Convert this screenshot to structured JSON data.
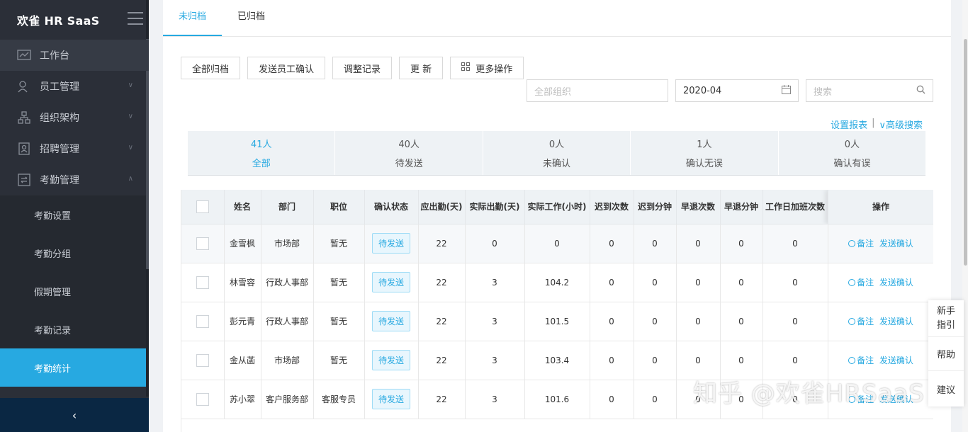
{
  "sidebar": {
    "logo": "欢雀 HR SaaS",
    "menu": [
      {
        "label": "工作台"
      },
      {
        "label": "员工管理"
      },
      {
        "label": "组织架构"
      },
      {
        "label": "招聘管理"
      },
      {
        "label": "考勤管理"
      }
    ],
    "submenu": [
      {
        "label": "考勤设置"
      },
      {
        "label": "考勤分组"
      },
      {
        "label": "假期管理"
      },
      {
        "label": "考勤记录"
      },
      {
        "label": "考勤统计"
      }
    ],
    "collapse_icon": "‹"
  },
  "tabs": [
    {
      "label": "未归档"
    },
    {
      "label": "已归档"
    }
  ],
  "toolbar": {
    "archive_all": "全部归档",
    "send_confirm": "发送员工确认",
    "adjust_log": "调整记录",
    "refresh": "更 新",
    "more": "更多操作"
  },
  "filters": {
    "org_placeholder": "全部组织",
    "month": "2020-04",
    "search_placeholder": "搜索"
  },
  "links": {
    "report_settings": "设置报表",
    "advanced_search": "∨高级搜索"
  },
  "summary": [
    {
      "count": "41人",
      "label": "全部"
    },
    {
      "count": "40人",
      "label": "待发送"
    },
    {
      "count": "0人",
      "label": "未确认"
    },
    {
      "count": "1人",
      "label": "确认无误"
    },
    {
      "count": "0人",
      "label": "确认有误"
    }
  ],
  "table": {
    "headers": [
      "姓名",
      "部门",
      "职位",
      "确认状态",
      "应出勤(天)",
      "实际出勤(天)",
      "实际工作(小时)",
      "迟到次数",
      "迟到分钟",
      "早退次数",
      "早退分钟",
      "工作日加班次数",
      "操作"
    ],
    "rows": [
      {
        "name": "金雪枫",
        "dept": "市场部",
        "pos": "暂无",
        "status": "待发送",
        "due": "22",
        "actual": "0",
        "hours": "0",
        "late": "0",
        "late_min": "0",
        "early": "0",
        "early_min": "0",
        "ot": "0"
      },
      {
        "name": "林雪容",
        "dept": "行政人事部",
        "pos": "暂无",
        "status": "待发送",
        "due": "22",
        "actual": "3",
        "hours": "104.2",
        "late": "0",
        "late_min": "0",
        "early": "0",
        "early_min": "0",
        "ot": "0"
      },
      {
        "name": "彭元青",
        "dept": "行政人事部",
        "pos": "暂无",
        "status": "待发送",
        "due": "22",
        "actual": "3",
        "hours": "101.5",
        "late": "0",
        "late_min": "0",
        "early": "0",
        "early_min": "0",
        "ot": "0"
      },
      {
        "name": "金从菡",
        "dept": "市场部",
        "pos": "暂无",
        "status": "待发送",
        "due": "22",
        "actual": "3",
        "hours": "103.4",
        "late": "0",
        "late_min": "0",
        "early": "0",
        "early_min": "0",
        "ot": "0"
      },
      {
        "name": "苏小翠",
        "dept": "客户服务部",
        "pos": "客服专员",
        "status": "待发送",
        "due": "22",
        "actual": "3",
        "hours": "101.6",
        "late": "0",
        "late_min": "0",
        "early": "0",
        "early_min": "0",
        "ot": "0"
      }
    ],
    "op_note": "备注",
    "op_send": "发送确认"
  },
  "float_panel": {
    "guide": "新手指引",
    "help": "帮助",
    "suggest": "建议"
  },
  "watermark": "知乎 @欢雀HRSaaS"
}
